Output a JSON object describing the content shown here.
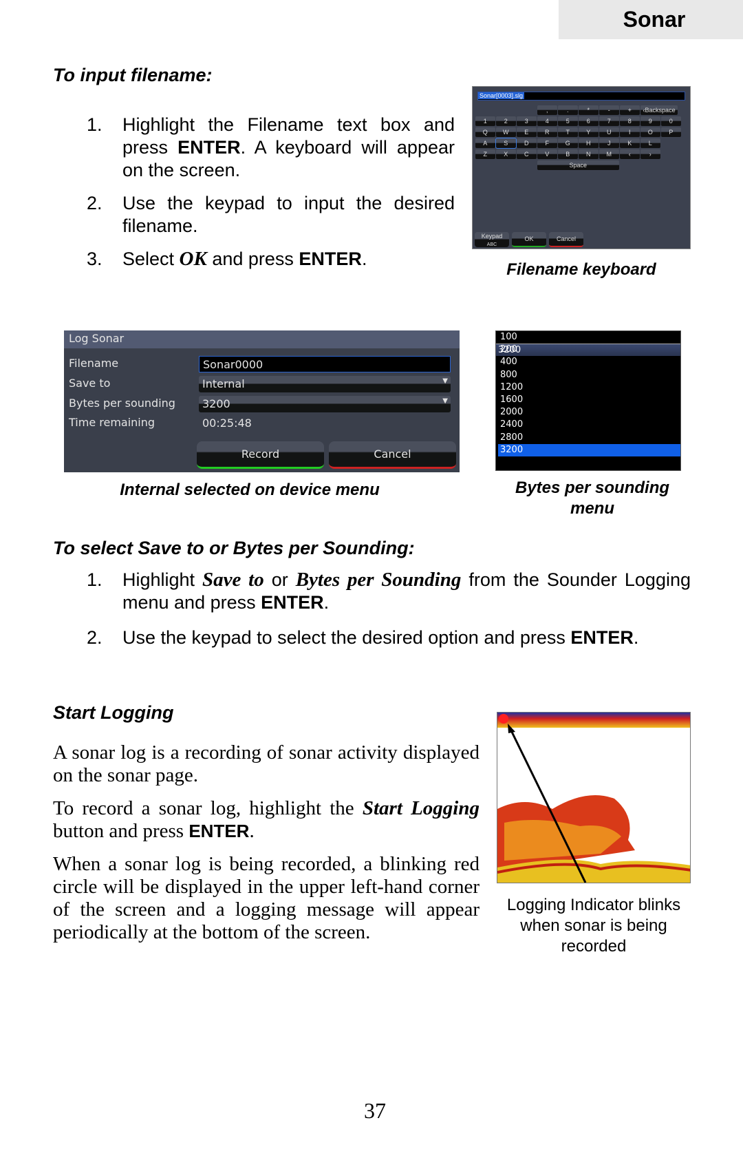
{
  "header": {
    "section": "Sonar"
  },
  "input_filename": {
    "heading": "To input filename:",
    "steps": [
      {
        "n": "1.",
        "parts": [
          "Highlight the Filename text box and press ",
          "ENTER",
          ". A keyboard will appear on the screen."
        ]
      },
      {
        "n": "2.",
        "text": "Use the keypad to input the desired filename."
      },
      {
        "n": "3.",
        "parts": [
          "Select ",
          "OK",
          " and press ",
          "ENTER",
          "."
        ]
      }
    ]
  },
  "keyboard_figure": {
    "filename_value": "Sonar[0003].slg",
    "row0": [
      ",",
      ".",
      "*",
      "-",
      "+",
      "‹Backspace"
    ],
    "row1": [
      "1",
      "2",
      "3",
      "4",
      "5",
      "6",
      "7",
      "8",
      "9",
      "0"
    ],
    "row2": [
      "Q",
      "W",
      "E",
      "R",
      "T",
      "Y",
      "U",
      "I",
      "O",
      "P"
    ],
    "row3": [
      "A",
      "S",
      "D",
      "F",
      "G",
      "H",
      "J",
      "K",
      "L"
    ],
    "row4": [
      "Z",
      "X",
      "C",
      "V",
      "B",
      "N",
      "M",
      "‹",
      "›"
    ],
    "space": "Space",
    "selected_key": "S",
    "buttons": {
      "keypad": "Keypad",
      "keypad_sub": "ABC",
      "ok": "OK",
      "cancel": "Cancel"
    },
    "caption": "Filename keyboard"
  },
  "log_sonar": {
    "title": "Log Sonar",
    "filename_label": "Filename",
    "filename_value": "Sonar0000",
    "save_to_label": "Save to",
    "save_to_value": "Internal",
    "bytes_label": "Bytes per sounding",
    "bytes_value": "3200",
    "time_label": "Time remaining",
    "time_value": "00:25:48",
    "record": "Record",
    "cancel": "Cancel",
    "caption": "Internal selected on device menu"
  },
  "bytes_menu": {
    "options": [
      "100",
      "200",
      "400",
      "800",
      "1200",
      "1600",
      "2000",
      "2400",
      "2800",
      "3200"
    ],
    "highlighted": "3200",
    "current": "3200",
    "caption_line1": "Bytes per sounding",
    "caption_line2": "menu"
  },
  "select_save": {
    "heading": "To select Save to or Bytes per Sounding:",
    "step1": {
      "n": "1.",
      "a": "Highlight ",
      "b": "Save to",
      "c": " or ",
      "d": "Bytes per Sounding",
      "e": " from the Sounder Logging menu and press ",
      "f": "ENTER",
      "g": "."
    },
    "step2": {
      "n": "2.",
      "a": "Use the keypad to select the desired option and press ",
      "b": "ENTER",
      "c": "."
    }
  },
  "start_logging": {
    "heading": "Start Logging",
    "p1": "A sonar log is a recording of sonar activity displayed on the sonar page.",
    "p2a": "To record a sonar log, highlight the ",
    "p2b": "Start Logging",
    "p2c": " button and press ",
    "p2d": "ENTER",
    "p2e": ".",
    "p3": "When a sonar log is being recorded, a blinking red circle will be displayed in the upper left-hand corner of the screen and a logging message will appear periodically at the bottom of the screen.",
    "caption": [
      "Logging Indicator blinks",
      "when sonar is being",
      "recorded"
    ]
  },
  "page_number": "37"
}
